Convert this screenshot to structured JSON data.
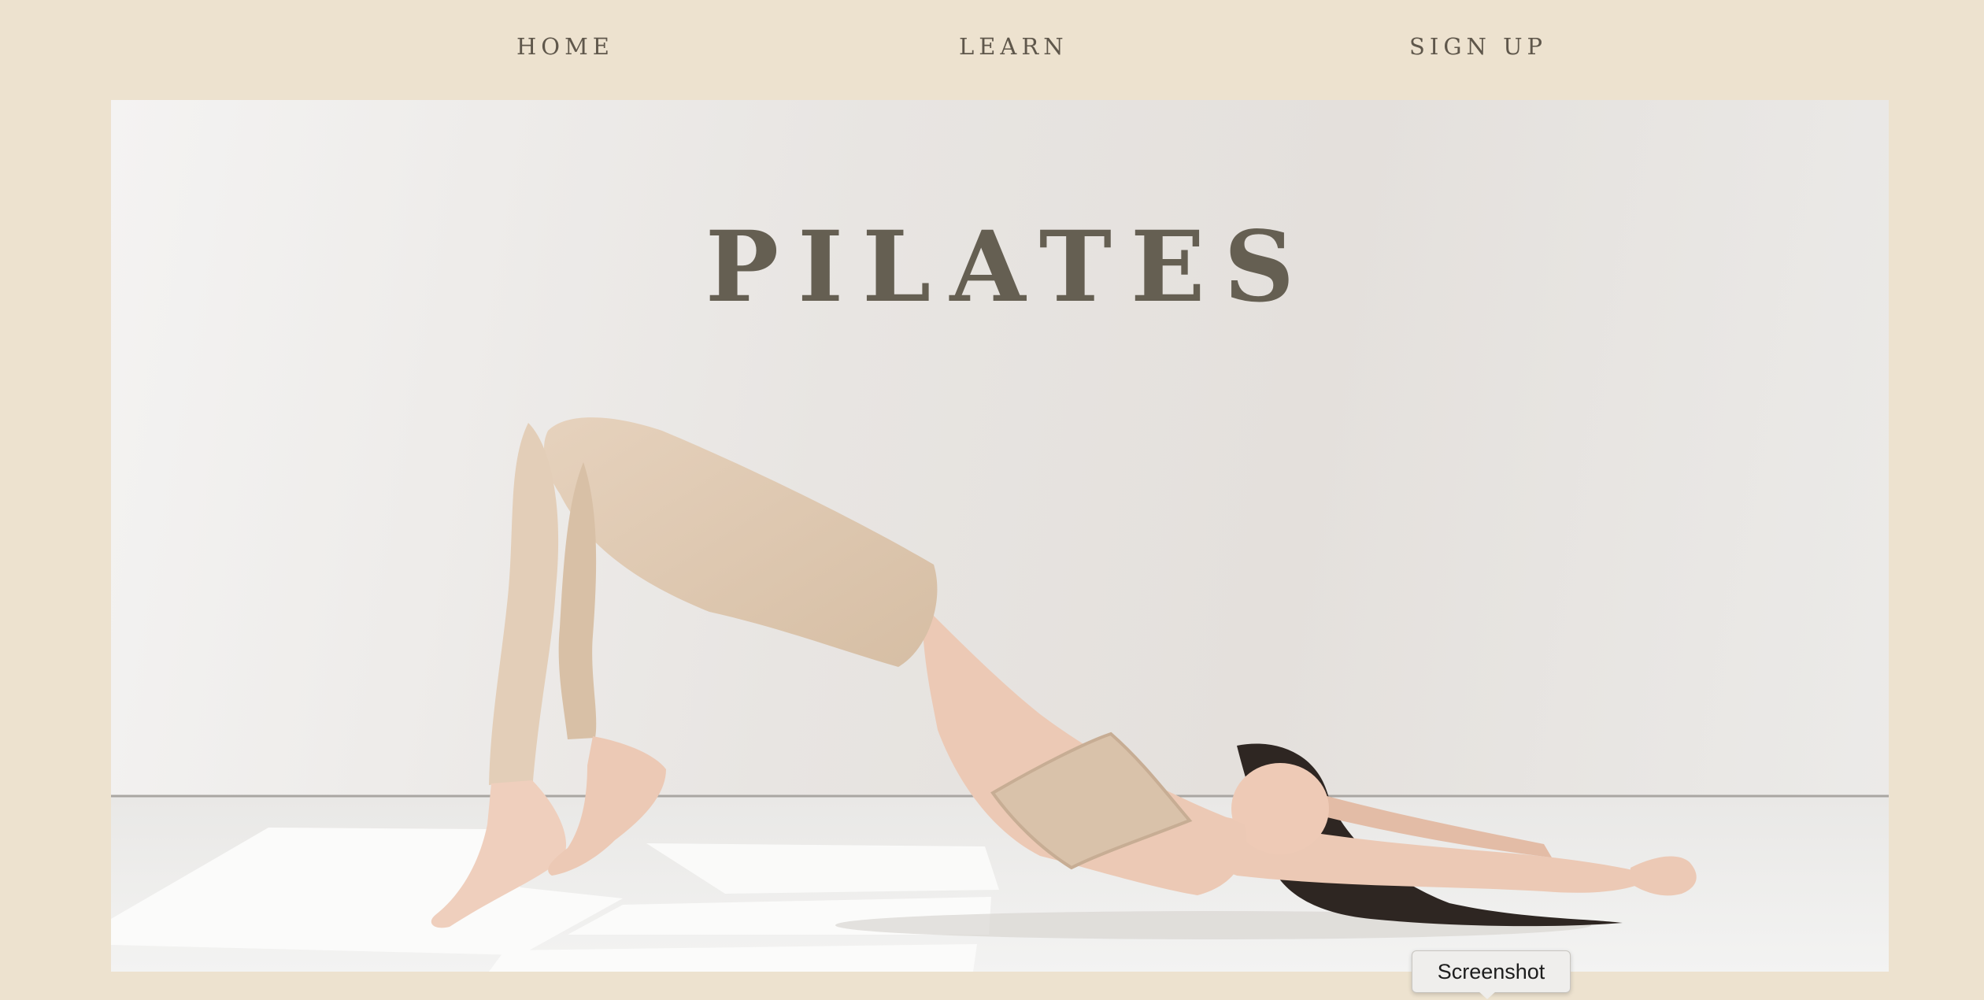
{
  "nav": {
    "home_label": "HOME",
    "learn_label": "LEARN",
    "signup_label": "SIGN UP"
  },
  "hero": {
    "title": "PILATES",
    "image_subject": "woman in beige activewear doing a glute bridge on a white floor"
  },
  "tooltip": {
    "label": "Screenshot"
  },
  "colors": {
    "page_background": "#ede2cf",
    "nav_text": "#5f574b",
    "title_text": "#655f52",
    "activewear": "#ddc6ad",
    "skin": "#ecc9b5",
    "hair": "#2e2622"
  }
}
